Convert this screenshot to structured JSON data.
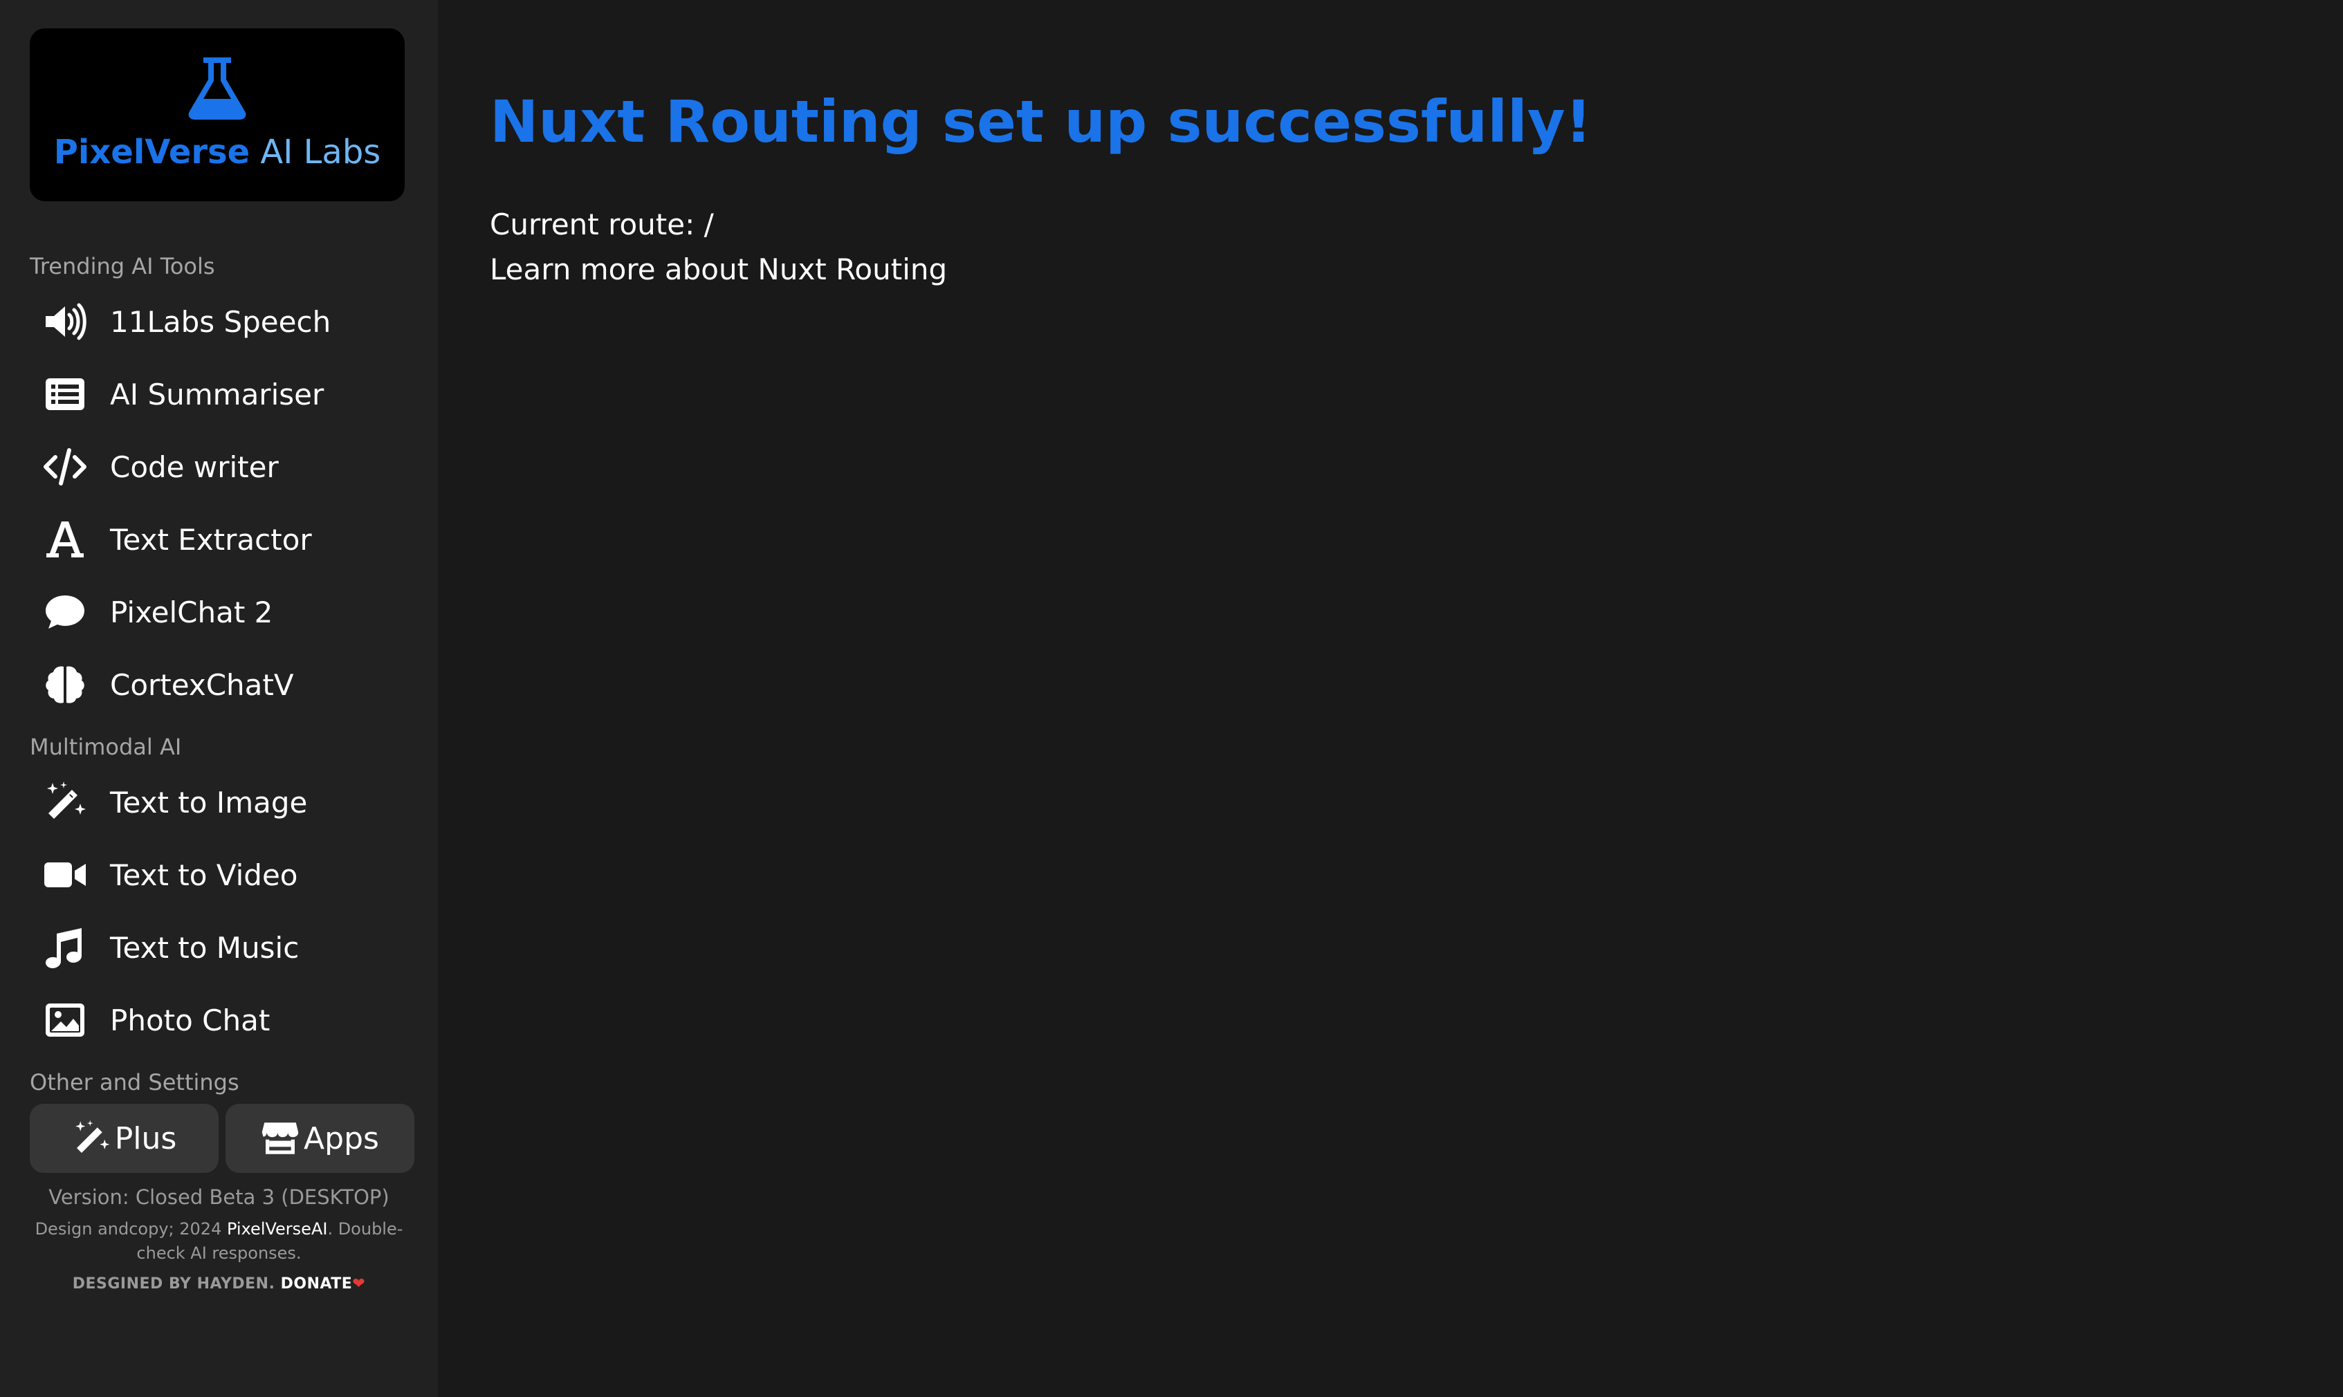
{
  "sidebar": {
    "logo": {
      "brand": "PixelVerse",
      "sub": " AI Labs",
      "icon": "flask-icon"
    },
    "sections": {
      "trending": "Trending AI Tools",
      "multimodal": "Multimodal AI",
      "other": "Other and Settings"
    },
    "trending_items": [
      {
        "label": "11Labs Speech",
        "icon": "speaker-icon"
      },
      {
        "label": "AI Summariser",
        "icon": "list-icon"
      },
      {
        "label": "Code writer",
        "icon": "code-icon"
      },
      {
        "label": "Text Extractor",
        "icon": "font-icon"
      },
      {
        "label": "PixelChat 2",
        "icon": "chat-bubble-icon"
      },
      {
        "label": "CortexChatV",
        "icon": "brain-icon"
      }
    ],
    "multimodal_items": [
      {
        "label": "Text to Image",
        "icon": "magic-wand-icon"
      },
      {
        "label": "Text to Video",
        "icon": "video-camera-icon"
      },
      {
        "label": "Text to Music",
        "icon": "music-note-icon"
      },
      {
        "label": "Photo Chat",
        "icon": "image-icon"
      }
    ],
    "buttons": {
      "plus": {
        "label": "Plus",
        "icon": "magic-wand-icon"
      },
      "apps": {
        "label": "Apps",
        "icon": "store-icon"
      }
    },
    "footer": {
      "version": "Version: Closed Beta 3 (DESKTOP)",
      "credit_prefix": "Design andcopy; 2024 ",
      "credit_link": "PixelVerseAI",
      "credit_suffix": ". Double-check AI responses.",
      "designed": "DESGINED BY HAYDEN. ",
      "donate": "DONATE",
      "heart": "❤"
    }
  },
  "main": {
    "title": "Nuxt Routing set up successfully!",
    "route_label": "Current route: /",
    "learn_link": "Learn more about Nuxt Routing"
  },
  "colors": {
    "accent": "#1a73e8",
    "logo_sub": "#6fb6f3",
    "sidebar_bg": "#212121",
    "main_bg": "#191919",
    "button_bg": "#363636"
  }
}
